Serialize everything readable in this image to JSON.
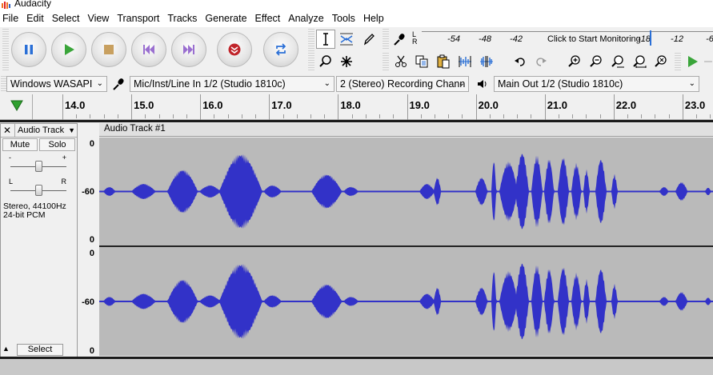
{
  "window": {
    "title": "Audacity"
  },
  "menu": [
    "File",
    "Edit",
    "Select",
    "View",
    "Transport",
    "Tracks",
    "Generate",
    "Effect",
    "Analyze",
    "Tools",
    "Help"
  ],
  "transport": {
    "buttons": [
      "pause",
      "play",
      "stop",
      "skip-to-start",
      "skip-to-end",
      "record",
      "loop"
    ]
  },
  "tools": {
    "selection": "selection-tool",
    "envelope": "envelope-tool",
    "draw": "draw-tool",
    "zoom": "zoom-tool",
    "multi": "multi-tool"
  },
  "meter": {
    "rec_channels": "L\nR",
    "ticks": [
      "-54",
      "-48",
      "-42",
      "-18",
      "-12",
      "-6"
    ],
    "start_monitoring": "Click to Start Monitoring",
    "peak_marker_db": -18
  },
  "devices": {
    "host": "Windows WASAPI",
    "rec_device": "Mic/Inst/Line In 1/2 (Studio 1810c)",
    "rec_channels": "2 (Stereo) Recording Chann",
    "play_device": "Main Out 1/2 (Studio 1810c)"
  },
  "ruler": {
    "labels": [
      "14.0",
      "15.0",
      "16.0",
      "17.0",
      "18.0",
      "19.0",
      "20.0",
      "21.0",
      "22.0",
      "23.0"
    ]
  },
  "track": {
    "name": "Audio Track",
    "clip_name": "Audio Track #1",
    "mute_label": "Mute",
    "solo_label": "Solo",
    "gain_minus": "-",
    "gain_plus": "+",
    "pan_left": "L",
    "pan_right": "R",
    "info_line1": "Stereo, 44100Hz",
    "info_line2": "24-bit PCM",
    "select_label": "Select",
    "scale": [
      "0",
      "-60",
      "0"
    ],
    "gain_level": 0.5,
    "pan_level": 0.5
  },
  "colors": {
    "waveform": "#3232c8",
    "waveform_bg": "#bababa",
    "accent_green": "#2ea02e",
    "record_red": "#c0242a"
  }
}
